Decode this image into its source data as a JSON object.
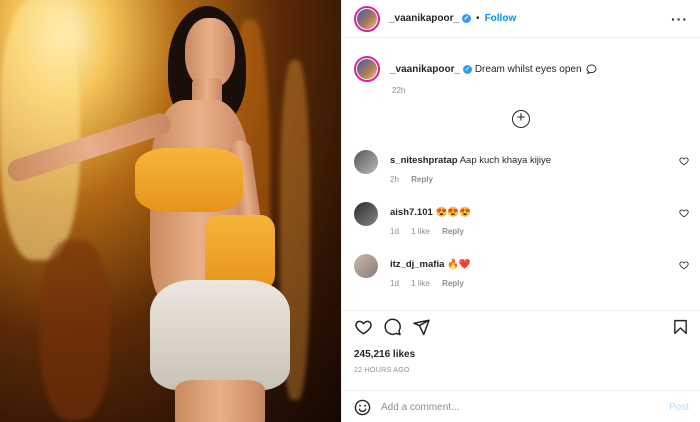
{
  "post": {
    "username": "_vaanikapoor_",
    "verified_mark": "✓",
    "dot": "•",
    "follow_label": "Follow",
    "more_label": "···"
  },
  "caption": {
    "username": "_vaanikapoor_",
    "text": "Dream whilst eyes open",
    "time": "22h"
  },
  "comments": [
    {
      "username": "s_niteshpratap",
      "text": "Aap kuch khaya kijiye",
      "time": "2h",
      "likes": "",
      "reply": "Reply"
    },
    {
      "username": "aish7.101",
      "text": "😍😍😍",
      "time": "1d",
      "likes": "1 like",
      "reply": "Reply"
    },
    {
      "username": "itz_dj_mafia",
      "text": "🔥❤️",
      "time": "1d",
      "likes": "1 like",
      "reply": "Reply"
    }
  ],
  "stats": {
    "likes": "245,216 likes",
    "ago": "22 HOURS AGO"
  },
  "add_comment": {
    "placeholder": "Add a comment...",
    "post_label": "Post"
  },
  "icons": {
    "like": "heart-icon",
    "comment": "comment-icon",
    "share": "share-icon",
    "save": "bookmark-icon",
    "emoji": "emoji-icon",
    "load_more": "plus-circle-icon"
  },
  "colors": {
    "accent": "#0095f6",
    "post_disabled": "#b2dffc",
    "muted": "#8e8e8e",
    "verified": "#3897f0"
  }
}
